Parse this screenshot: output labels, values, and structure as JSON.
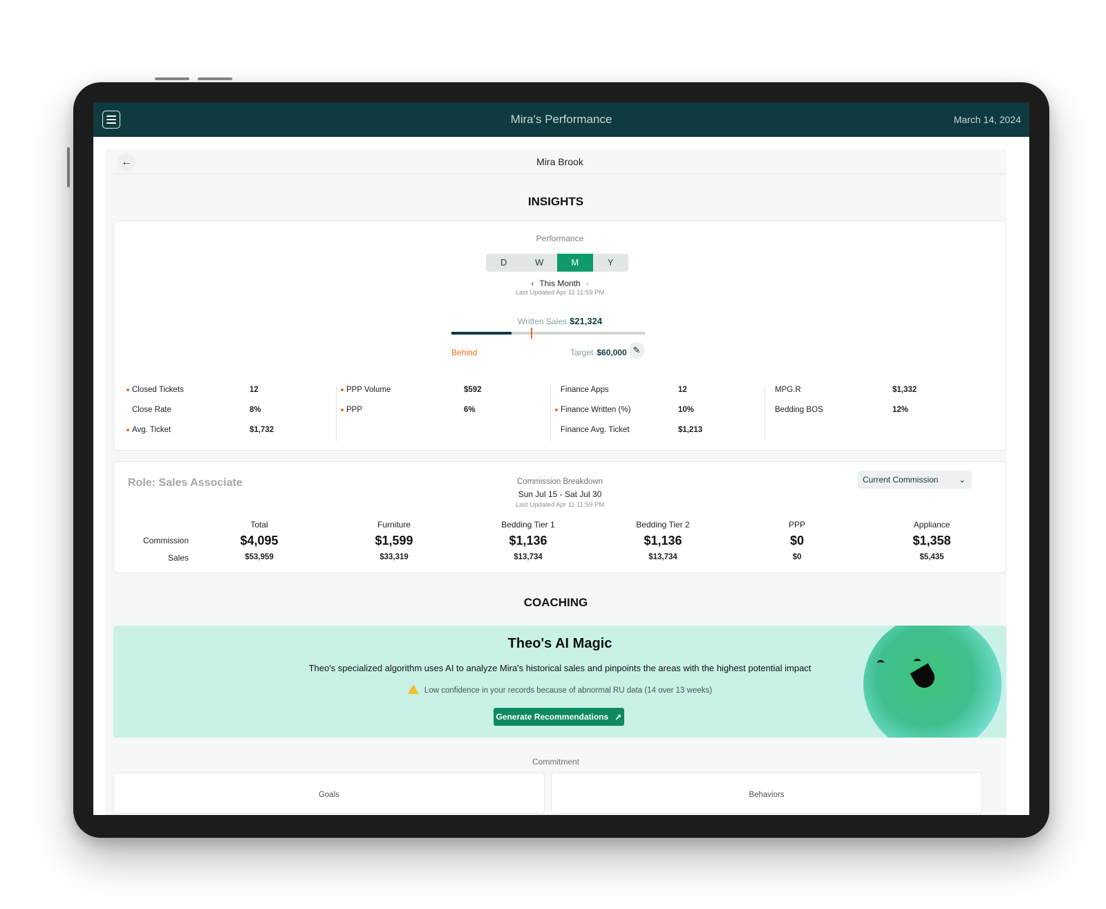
{
  "header": {
    "title": "Mira's Performance",
    "date": "March 14, 2024"
  },
  "page": {
    "person_name": "Mira Brook"
  },
  "insights": {
    "section_title": "INSIGHTS",
    "performance_label": "Performance",
    "periods": [
      "D",
      "W",
      "M",
      "Y"
    ],
    "active_period": "M",
    "period_label": "This Month",
    "last_updated": "Last Updated  Apr 11   11:59 PM",
    "written_sales_label": "Written Sales",
    "written_sales_value": "$21,324",
    "progress_fraction": 0.31,
    "marker_fraction": 0.41,
    "status": "Behind",
    "target_label": "Target",
    "target_value": "$60,000",
    "metric_columns": [
      [
        {
          "label": "Closed Tickets",
          "value": "12",
          "flag": true
        },
        {
          "label": "Close Rate",
          "value": "8%",
          "flag": false
        },
        {
          "label": "Avg. Ticket",
          "value": "$1,732",
          "flag": true
        }
      ],
      [
        {
          "label": "PPP Volume",
          "value": "$592",
          "flag": true
        },
        {
          "label": "PPP",
          "value": "6%",
          "flag": true
        }
      ],
      [
        {
          "label": "Finance Apps",
          "value": "12",
          "flag": false
        },
        {
          "label": "Finance Written (%)",
          "value": "10%",
          "flag": true
        },
        {
          "label": "Finance Avg. Ticket",
          "value": "$1,213",
          "flag": false
        }
      ],
      [
        {
          "label": "MPG.R",
          "value": "$1,332",
          "flag": false
        },
        {
          "label": "Bedding BOS",
          "value": "12%",
          "flag": false
        }
      ]
    ]
  },
  "commission": {
    "role": "Role: Sales Associate",
    "title": "Commission Breakdown",
    "range": "Sun Jul 15 - Sat Jul 30",
    "last_updated": "Last Updated  Apr 11   11:59 PM",
    "dropdown_value": "Current Commission",
    "row_labels": [
      "Commission",
      "Sales"
    ],
    "columns": [
      {
        "header": "Total",
        "commission": "$4,095",
        "sales": "$53,959"
      },
      {
        "header": "Furniture",
        "commission": "$1,599",
        "sales": "$33,319"
      },
      {
        "header": "Bedding Tier 1",
        "commission": "$1,136",
        "sales": "$13,734"
      },
      {
        "header": "Bedding Tier 2",
        "commission": "$1,136",
        "sales": "$13,734"
      },
      {
        "header": "PPP",
        "commission": "$0",
        "sales": "$0"
      },
      {
        "header": "Appliance",
        "commission": "$1,358",
        "sales": "$5,435"
      }
    ]
  },
  "coaching": {
    "section_title": "COACHING",
    "ai_title": "Theo's AI Magic",
    "ai_description": "Theo's specialized algorithm uses AI to analyze Mira's historical sales and pinpoints the areas with the highest potential impact",
    "warning": "Low confidence in your records because of abnormal RU data (14 over 13 weeks)",
    "button_label": "Generate Recommendations",
    "commitment_label": "Commitment",
    "goals_label": "Goals",
    "behaviors_label": "Behaviors"
  },
  "colors": {
    "brand_dark": "#0d3b3f",
    "accent_green": "#0f9a6c",
    "warning_orange": "#f26a21",
    "banner_bg": "#c9f1e7"
  },
  "icons": {
    "menu": "hamburger-icon",
    "back": "arrow-left-icon",
    "edit": "pencil-icon",
    "dropdown": "chevron-down-icon",
    "warning": "warning-icon",
    "magic": "magic-wand-icon"
  }
}
